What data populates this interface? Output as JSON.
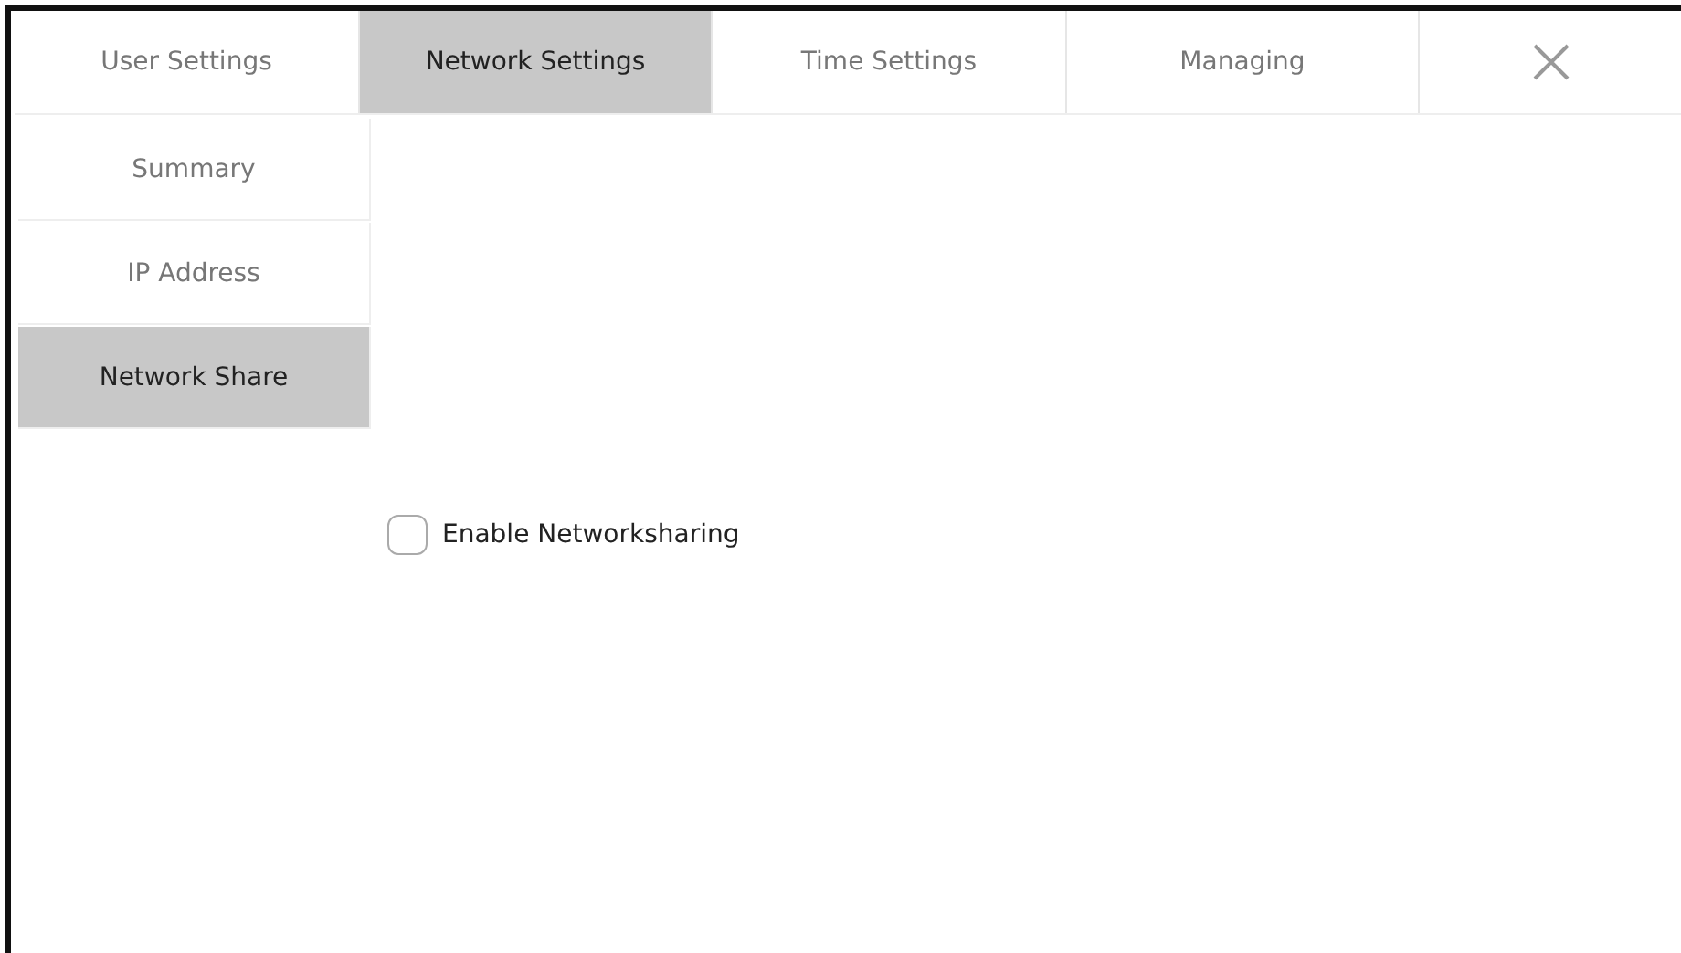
{
  "tabs": [
    {
      "label": "User Settings",
      "selected": false
    },
    {
      "label": "Network Settings",
      "selected": true
    },
    {
      "label": "Time Settings",
      "selected": false
    },
    {
      "label": "Managing",
      "selected": false
    }
  ],
  "close_button": {
    "kind": "close"
  },
  "sidebar": {
    "items": [
      {
        "label": "Summary",
        "selected": false
      },
      {
        "label": "IP Address",
        "selected": false
      },
      {
        "label": "Network Share",
        "selected": true
      }
    ]
  },
  "options": [
    {
      "label": "Enable Networksharing",
      "checked": false
    }
  ]
}
